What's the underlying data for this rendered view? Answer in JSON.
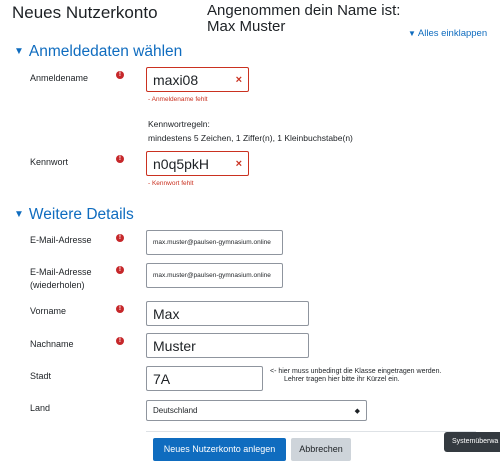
{
  "header": {
    "title": "Neues Nutzerkonto",
    "name_hint_line1": "Angenommen dein Name ist:",
    "name_hint_line2": "Max Muster",
    "collapse_all": "Alles einklappen"
  },
  "section_login": {
    "heading": "Anmeldedaten wählen",
    "username_label": "Anmeldename",
    "username_value": "maxi08",
    "username_error": "- Anmeldename fehlt",
    "password_rules_title": "Kennwortregeln:",
    "password_rules_text": "mindestens 5 Zeichen, 1 Ziffer(n), 1 Kleinbuchstabe(n)",
    "password_label": "Kennwort",
    "password_value": "n0q5pkH",
    "password_error": "- Kennwort fehlt"
  },
  "section_details": {
    "heading": "Weitere Details",
    "email_label": "E-Mail-Adresse",
    "email_value": "max.muster@paulsen-gymnasium.online",
    "email2_label_line1": "E-Mail-Adresse",
    "email2_label_line2": "(wiederholen)",
    "email2_value": "max.muster@paulsen-gymnasium.online",
    "firstname_label": "Vorname",
    "firstname_value": "Max",
    "lastname_label": "Nachname",
    "lastname_value": "Muster",
    "city_label": "Stadt",
    "city_value": "7A",
    "city_note_line1": "<- hier muss unbedingt die Klasse eingetragen werden.",
    "city_note_line2": "Lehrer tragen hier bitte ihr Kürzel ein.",
    "country_label": "Land",
    "country_value": "Deutschland"
  },
  "buttons": {
    "submit": "Neues Nutzerkonto anlegen",
    "cancel": "Abbrechen"
  },
  "system_button": "Systemüberwa",
  "icons": {
    "required": "exclamation-circle-icon",
    "error_clear": "x-icon",
    "collapse": "caret-down-icon",
    "select_arrow": "up-down-arrow-icon"
  },
  "colors": {
    "accent": "#0f6cbf",
    "error": "#ca3120",
    "required": "#c6272a"
  }
}
